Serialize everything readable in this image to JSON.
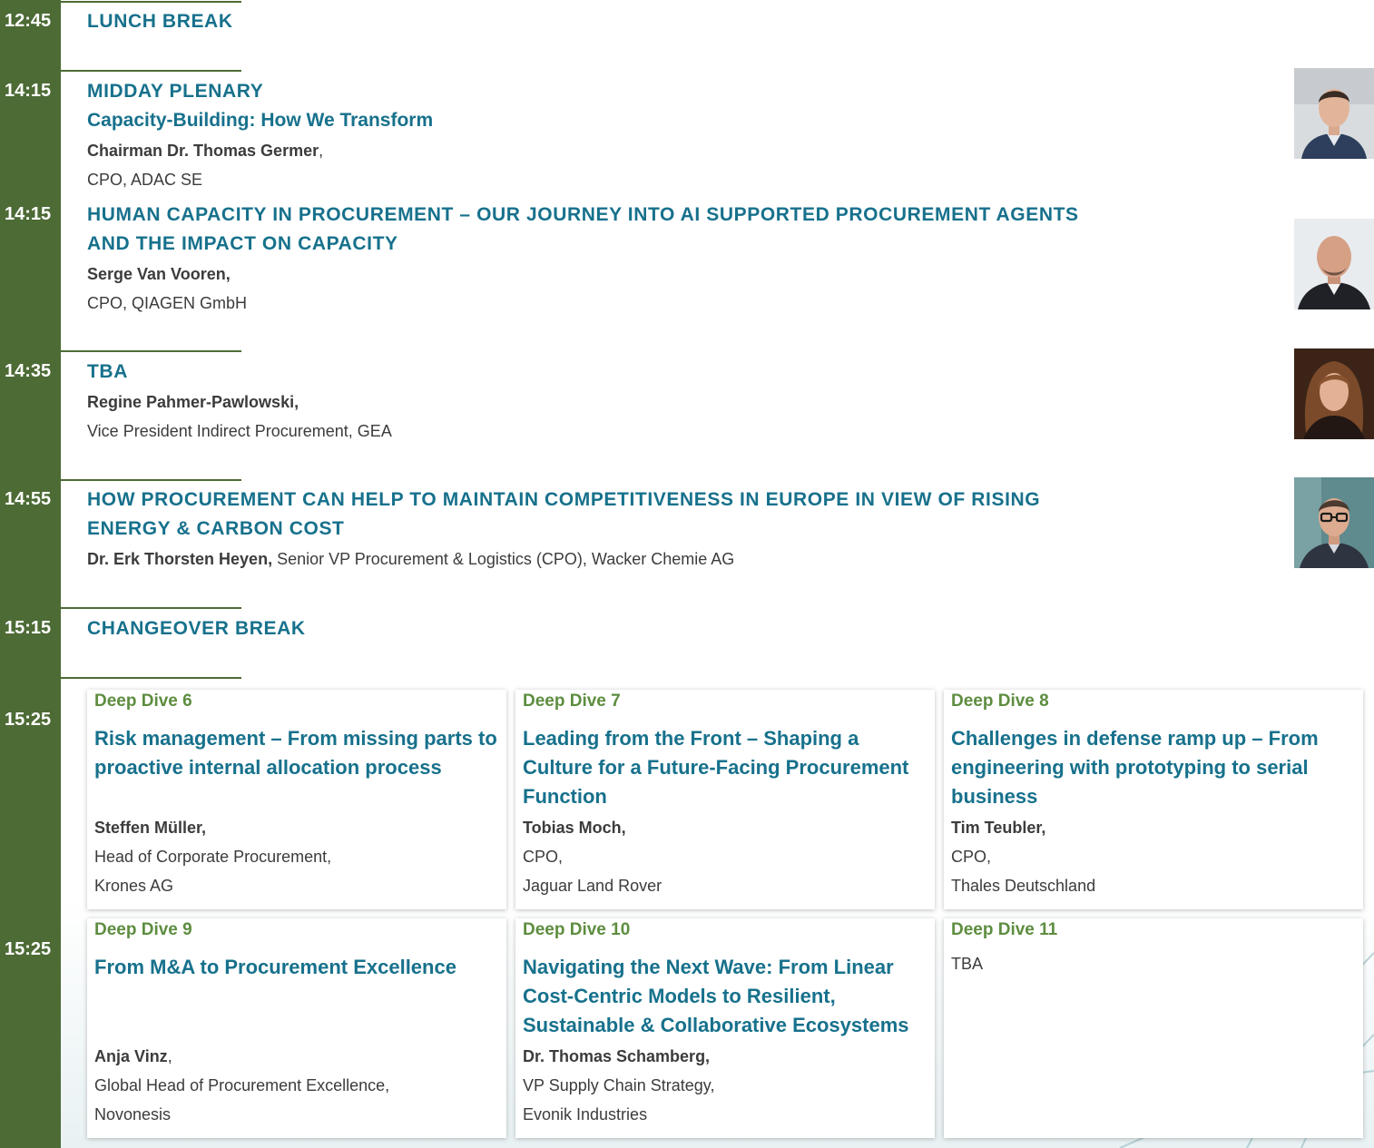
{
  "agenda": [
    {
      "time": "12:45",
      "title": "LUNCH BREAK"
    },
    {
      "time": "14:15",
      "title": "MIDDAY PLENARY",
      "subtitle": "Capacity-Building: How We Transform",
      "speaker_prefix": "Chairman ",
      "speaker": "Dr. Thomas Germer",
      "speaker_suffix": ",",
      "role": "CPO, ADAC SE",
      "photo": "speaker-portrait-man-blue-shirt"
    },
    {
      "time": "14:15",
      "title": "HUMAN CAPACITY IN PROCUREMENT – OUR JOURNEY INTO AI SUPPORTED PROCUREMENT AGENTS AND THE IMPACT ON CAPACITY",
      "speaker": "Serge Van Vooren,",
      "role": "CPO, QIAGEN GmbH",
      "photo": "speaker-portrait-bald-man"
    },
    {
      "time": "14:35",
      "title": "TBA",
      "speaker": "Regine Pahmer-Pawlowski,",
      "role": "Vice President Indirect Procurement, GEA",
      "photo": "speaker-portrait-woman"
    },
    {
      "time": "14:55",
      "title": "HOW PROCUREMENT CAN HELP TO MAINTAIN COMPETITIVENESS IN EUROPE IN VIEW OF RISING ENERGY & CARBON COST",
      "speaker": "Dr. Erk Thorsten Heyen,",
      "role": " Senior VP Procurement & Logistics (CPO), Wacker Chemie AG",
      "photo": "speaker-portrait-man-glasses"
    },
    {
      "time": "15:15",
      "title": "CHANGEOVER BREAK"
    }
  ],
  "deep_dive_times": [
    "15:25",
    "15:25"
  ],
  "deep_dives": [
    {
      "label": "Deep Dive 6",
      "title": "Risk management – From missing parts to proactive internal allocation process",
      "speaker": "Steffen Müller,",
      "role": "Head of Corporate Procurement,",
      "org": "Krones AG"
    },
    {
      "label": "Deep Dive 7",
      "title": "Leading from the Front – Shaping a Culture for a Future-Facing Procurement Function",
      "speaker": "Tobias Moch,",
      "role": "CPO,",
      "org": "Jaguar Land Rover"
    },
    {
      "label": "Deep Dive 8",
      "title": "Challenges in defense ramp up – From engineering with prototyping to serial business",
      "speaker": "Tim Teubler,",
      "role": "CPO,",
      "org": "Thales Deutschland"
    },
    {
      "label": "Deep Dive 9",
      "title": "From M&A to Procurement Excellence",
      "speaker": "Anja Vinz",
      "speaker_suffix": ",",
      "role": "Global Head of Procurement Excellence,",
      "org": "Novonesis"
    },
    {
      "label": "Deep Dive 10",
      "title": "Navigating the Next Wave: From Linear Cost-Centric Models to Resilient, Sustainable & Collaborative Ecosystems",
      "speaker": "Dr. Thomas Schamberg,",
      "role": "VP Supply Chain Strategy,",
      "org": "Evonik Industries"
    },
    {
      "label": "Deep Dive 11",
      "body": "TBA"
    }
  ],
  "colors": {
    "green": "#4d6b35",
    "teal": "#17718c",
    "deep_dive_label": "#5d8d3f",
    "text": "#3c3c3c"
  }
}
